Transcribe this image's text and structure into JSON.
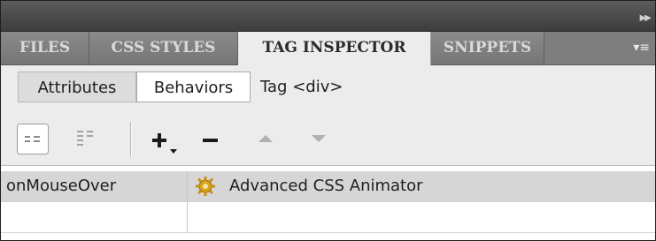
{
  "panel": {
    "tabs": [
      {
        "label": "FILES",
        "active": false
      },
      {
        "label": "CSS STYLES",
        "active": false
      },
      {
        "label": "TAG INSPECTOR",
        "active": true
      },
      {
        "label": "SNIPPETS",
        "active": false
      }
    ],
    "collapse_icon": "double-chevron-right-icon",
    "menu_icon": "panel-menu-icon"
  },
  "subtabs": {
    "attributes": "Attributes",
    "behaviors": "Behaviors",
    "active": "behaviors",
    "tag_label": "Tag <div>"
  },
  "toolbar": {
    "show_set_events": "show-set-events-icon",
    "show_all_events": "show-all-events-icon",
    "add": "add-behavior-icon",
    "remove": "remove-behavior-icon",
    "move_up": "move-up-icon",
    "move_down": "move-down-icon"
  },
  "behaviors": [
    {
      "event": "onMouseOver",
      "action": "Advanced CSS Animator",
      "icon": "gear-icon",
      "selected": true
    },
    {
      "event": "",
      "action": "",
      "selected": false
    }
  ],
  "colors": {
    "titlebar": "#4a4a4a",
    "tabbar": "#7e7e7e",
    "panel_bg": "#ececec",
    "selected_row": "#d6d6d6"
  }
}
